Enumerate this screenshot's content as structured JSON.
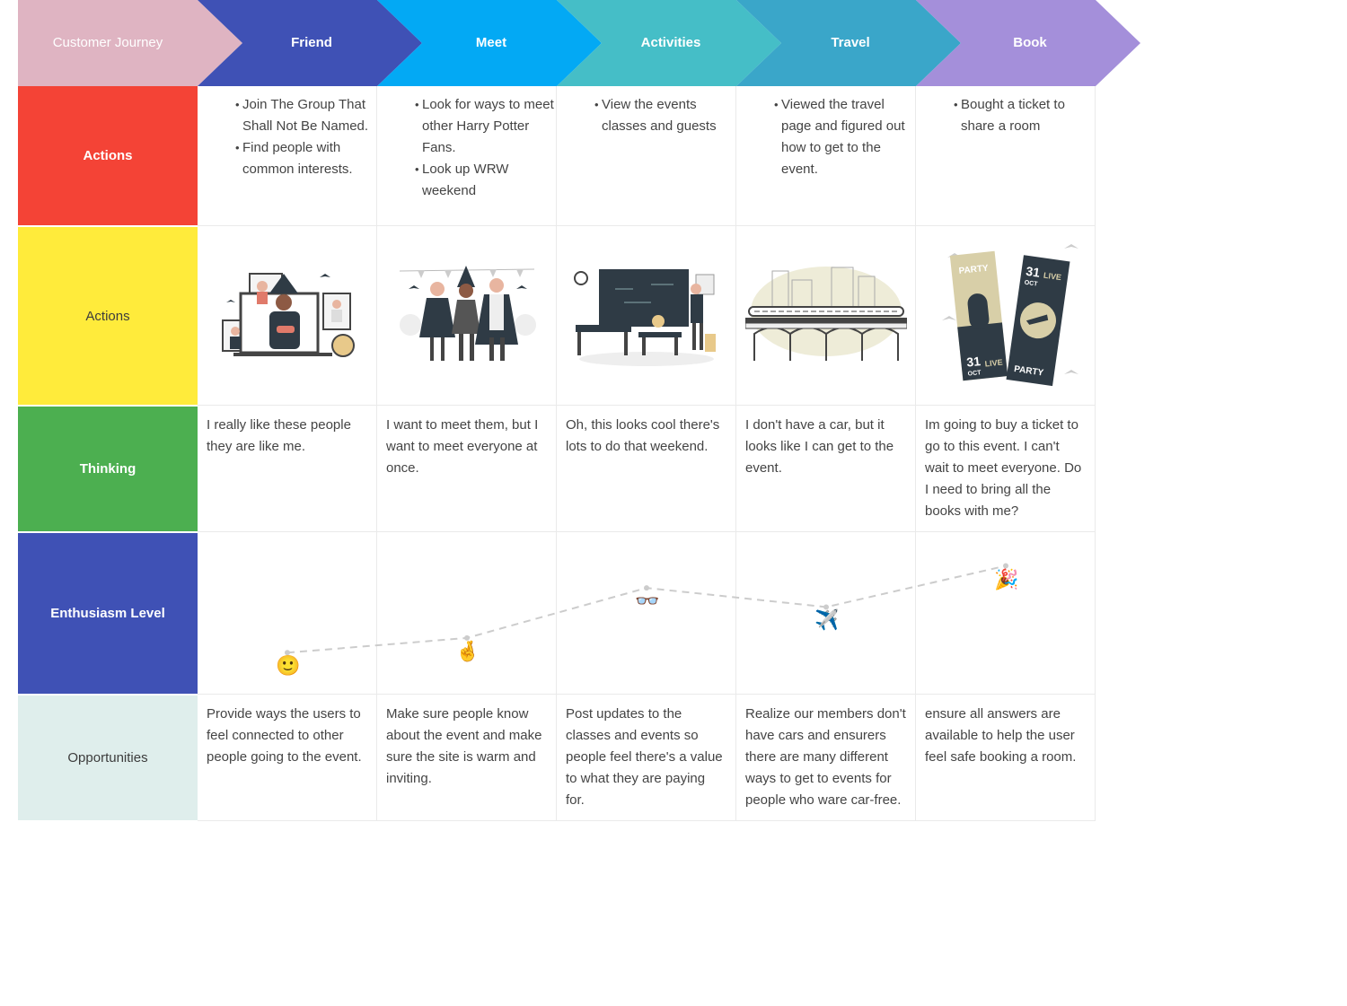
{
  "header": {
    "stages": [
      "Customer Journey",
      "Friend",
      "Meet",
      "Activities",
      "Travel",
      "Book"
    ],
    "colors": [
      "#dfb4c2",
      "#3f51b5",
      "#03a9f4",
      "#45bec7",
      "#3aa6c9",
      "#a48fda"
    ]
  },
  "rows": {
    "actions": {
      "label": "Actions",
      "color": "#f44336"
    },
    "illustrations": {
      "label": "Actions",
      "color": "#ffeb3b"
    },
    "thinking": {
      "label": "Thinking",
      "color": "#4caf50"
    },
    "enthusiasm": {
      "label": "Enthusiasm Level",
      "color": "#3f51b5"
    },
    "opportunities": {
      "label": "Opportunities",
      "color": "#dfeeec"
    }
  },
  "actions": [
    [
      "Join The Group That Shall Not Be Named.",
      "Find people with common interests."
    ],
    [
      "Look for ways to meet other Harry Potter Fans.",
      "Look up WRW weekend"
    ],
    [
      "View the events classes and guests"
    ],
    [
      "Viewed the travel page and figured out how to get to the event."
    ],
    [
      "Bought a ticket to share a room"
    ]
  ],
  "illustrations": {
    "icons": [
      "video-call-party-illustration",
      "halloween-friends-illustration",
      "classroom-illustration",
      "train-bridge-illustration",
      "halloween-tickets-illustration"
    ],
    "ticket_text": {
      "date_day": "31",
      "date_month": "OCT",
      "party": "PARTY",
      "live": "LIVE"
    }
  },
  "thinking": [
    "I really like these people they are like me.",
    "I want to meet them, but I want to meet everyone at once.",
    "Oh, this looks cool there's lots to do that weekend.",
    "I don't have a car, but it looks like I can get to the event.",
    "Im going to buy a ticket to go to this event. I can't wait to meet everyone. Do I need to bring all the books with me?"
  ],
  "chart_data": {
    "type": "line",
    "categories": [
      "Friend",
      "Meet",
      "Activities",
      "Travel",
      "Book"
    ],
    "values": [
      2.3,
      3.3,
      6.7,
      5.4,
      8.2
    ],
    "ylim": [
      0,
      10
    ],
    "emoji": [
      "🙂",
      "🤞",
      "👓",
      "✈️",
      "🎉"
    ],
    "line_color": "#cccccc",
    "grid": false
  },
  "opportunities": [
    "Provide ways the users to feel connected to other people going to the event.",
    "Make sure people know about the event and make sure the site is warm and inviting.",
    "Post updates to the classes and events so people feel there's a value to what they are paying for.",
    "Realize our members don't have cars and ensurers there are many different ways to get to events for people who ware car-free.",
    "ensure all answers are available to help the user feel safe booking a room."
  ]
}
